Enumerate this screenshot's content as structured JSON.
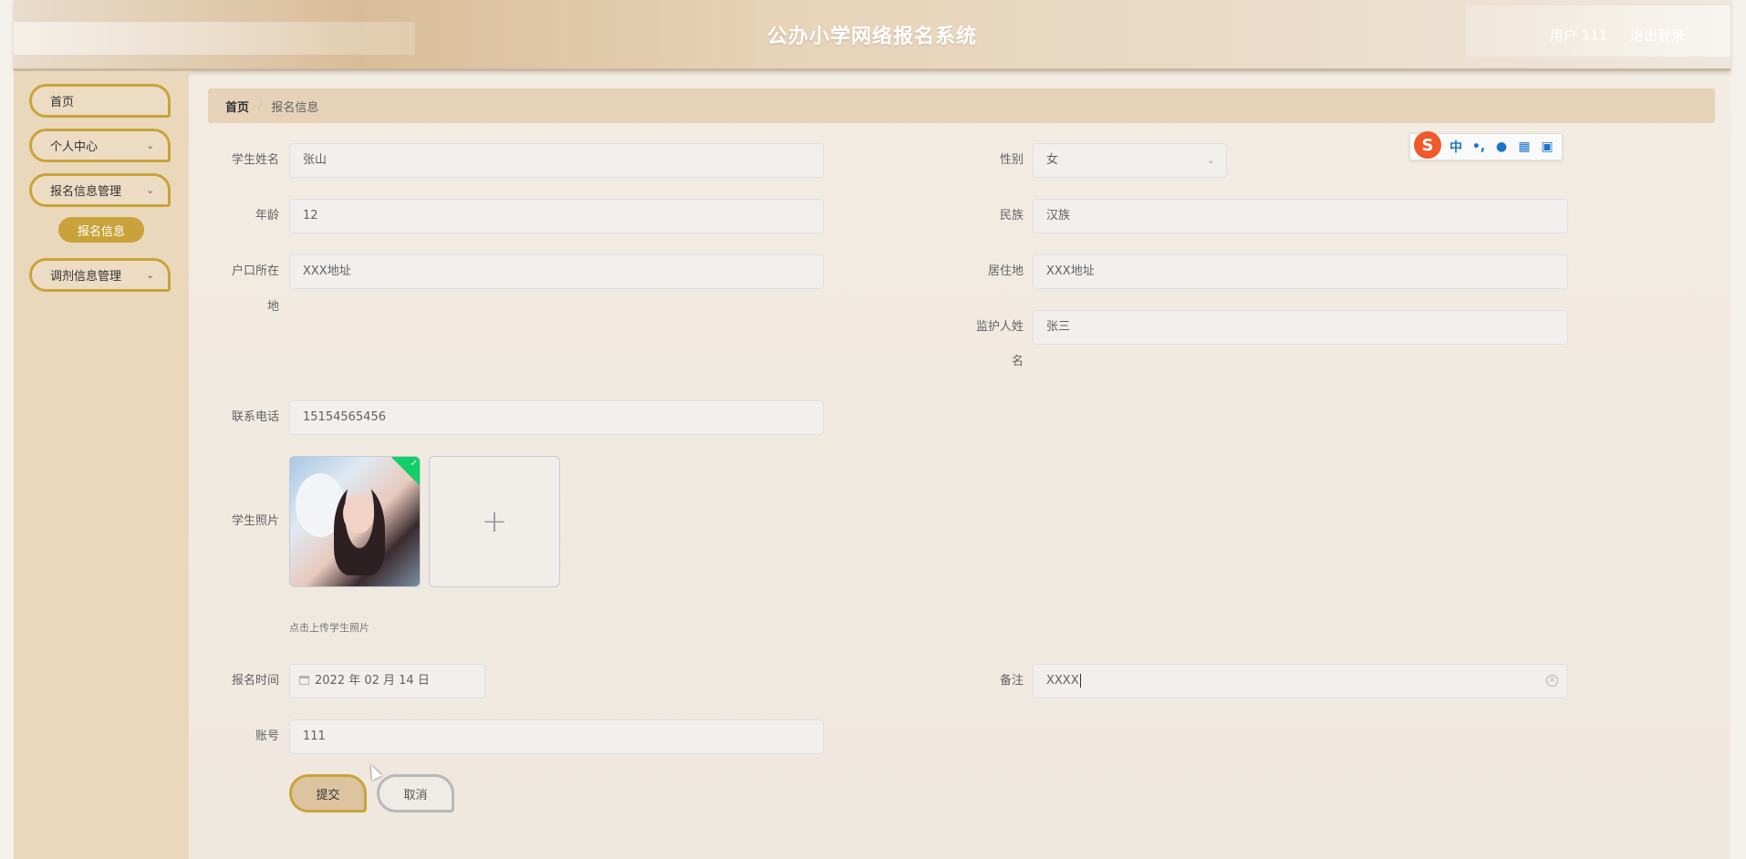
{
  "header": {
    "title": "公办小学网络报名系统",
    "user_label": "用户 111",
    "logout_label": "退出登录"
  },
  "sidebar": {
    "items": [
      {
        "label": "首页"
      },
      {
        "label": "个人中心"
      },
      {
        "label": "报名信息管理"
      },
      {
        "label": "调剂信息管理"
      }
    ],
    "active_sub": "报名信息"
  },
  "breadcrumb": {
    "home": "首页",
    "separator": "/",
    "current": "报名信息"
  },
  "form": {
    "student_name": {
      "label": "学生姓名",
      "value": "张山"
    },
    "gender": {
      "label": "性别",
      "value": "女"
    },
    "age": {
      "label": "年龄",
      "value": "12"
    },
    "ethnicity": {
      "label": "民族",
      "value": "汉族"
    },
    "hukou": {
      "label_line1": "户口所在",
      "label_line2": "地",
      "value": "XXX地址"
    },
    "residence": {
      "label": "居住地",
      "value": "XXX地址"
    },
    "guardian": {
      "label_line1": "监护人姓",
      "label_line2": "名",
      "value": "张三"
    },
    "phone": {
      "label": "联系电话",
      "value": "15154565456"
    },
    "photo": {
      "label": "学生照片",
      "upload_plus": "+",
      "tip": "点击上传学生照片"
    },
    "reg_time": {
      "label": "报名时间",
      "value": "2022 年 02 月 14 日"
    },
    "remark": {
      "label": "备注",
      "value": "XXXX"
    },
    "account": {
      "label": "账号",
      "value": "111"
    }
  },
  "buttons": {
    "submit": "提交",
    "cancel": "取消"
  },
  "ime": {
    "logo": "S",
    "mode": "中",
    "punct": "•,",
    "icons": [
      "mic-icon",
      "keyboard-icon",
      "grid-icon"
    ]
  },
  "colors": {
    "accent": "#c9a33a",
    "sidebar_bg": "#ead8bd",
    "breadcrumb_bg": "#e6d2b7",
    "success": "#13ce66"
  }
}
